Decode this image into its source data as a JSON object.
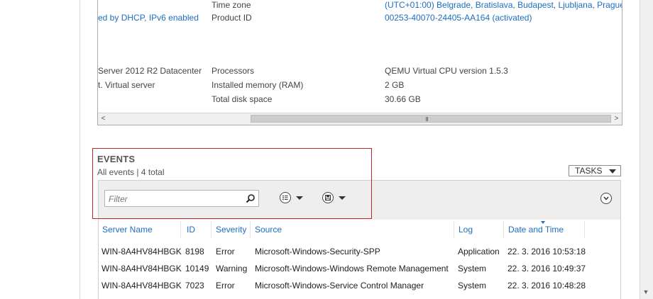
{
  "properties": {
    "rows": [
      {
        "left_value": "ed by DHCP, IPv6 enabled",
        "label": "Time zone",
        "value": "(UTC+01:00) Belgrade, Bratislava, Budapest, Ljubljana, Prague"
      },
      {
        "left_value": "",
        "label": "Product ID",
        "value": "00253-40070-24405-AA164 (activated)"
      },
      {
        "left_value": "Server 2012 R2 Datacenter",
        "label": "Processors",
        "value": "QEMU Virtual CPU version 1.5.3"
      },
      {
        "left_value": "t. Virtual server",
        "label": "Installed memory (RAM)",
        "value": "2 GB"
      },
      {
        "left_value": "",
        "label": "Total disk space",
        "value": "30.66 GB"
      }
    ],
    "scroll_left_glyph": "<",
    "scroll_right_glyph": ">",
    "scroll_grip": "III"
  },
  "events": {
    "title": "EVENTS",
    "subtitle": "All events | 4 total",
    "tasks_label": "TASKS",
    "filter_placeholder": "Filter",
    "columns": [
      "Server Name",
      "ID",
      "Severity",
      "Source",
      "Log",
      "Date and Time"
    ],
    "rows": [
      {
        "server": "WIN-8A4HV84HBGK",
        "id": "8198",
        "severity": "Error",
        "source": "Microsoft-Windows-Security-SPP",
        "log": "Application",
        "datetime": "22. 3. 2016 10:53:18"
      },
      {
        "server": "WIN-8A4HV84HBGK",
        "id": "10149",
        "severity": "Warning",
        "source": "Microsoft-Windows-Windows Remote Management",
        "log": "System",
        "datetime": "22. 3. 2016 10:49:37"
      },
      {
        "server": "WIN-8A4HV84HBGK",
        "id": "7023",
        "severity": "Error",
        "source": "Microsoft-Windows-Service Control Manager",
        "log": "System",
        "datetime": "22. 3. 2016 10:48:28"
      }
    ]
  },
  "icons": {
    "search": "search-icon",
    "list_options": "list-options-icon",
    "save_query": "save-icon",
    "expand": "chevron-down-icon",
    "scroll_down": "scroll-down-icon"
  },
  "colors": {
    "link": "#1c6ec2",
    "highlight_border": "#c0272d",
    "toolbar_bg": "#eeeeee"
  }
}
